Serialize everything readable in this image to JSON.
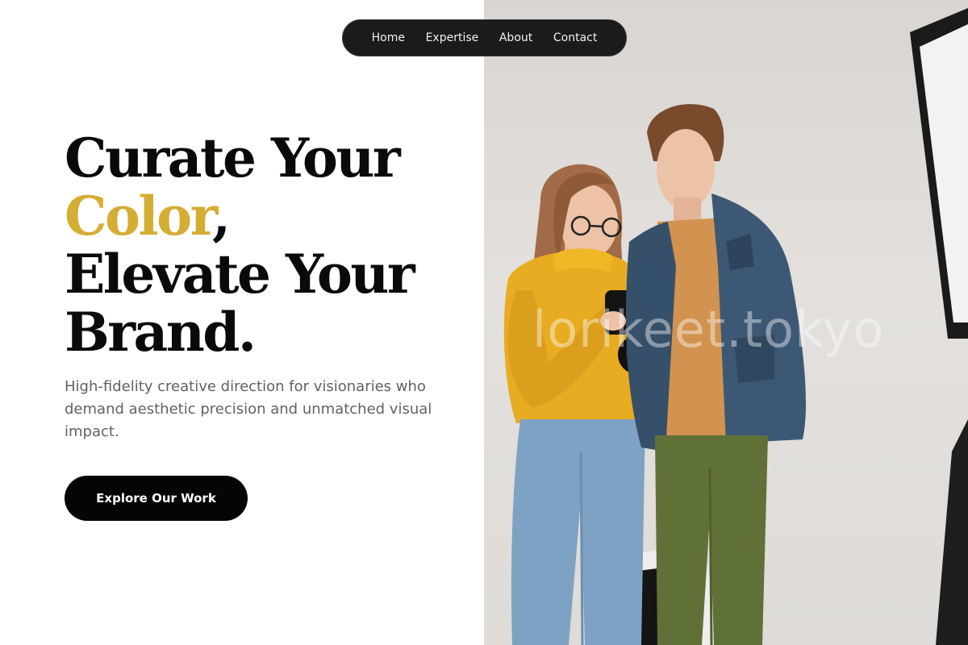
{
  "nav": {
    "items": [
      {
        "label": "Home"
      },
      {
        "label": "Expertise"
      },
      {
        "label": "About"
      },
      {
        "label": "Contact"
      }
    ]
  },
  "hero": {
    "title_line1": "Curate Your",
    "title_accent": "Color",
    "title_comma": ",",
    "title_line3": "Elevate Your",
    "title_line4": "Brand.",
    "subtitle": "High-fidelity creative direction for visionaries who demand aesthetic precision and unmatched visual impact.",
    "cta_label": "Explore Our Work"
  },
  "photo": {
    "watermark": "lorikeet.tokyo"
  },
  "colors": {
    "accent": "#d4ad33",
    "text_dark": "#0a0a0a",
    "subtitle": "#5e6266",
    "nav_bg": "#1b1b1b",
    "cta_bg": "#050505",
    "photo_bg": "#e0ddda"
  }
}
